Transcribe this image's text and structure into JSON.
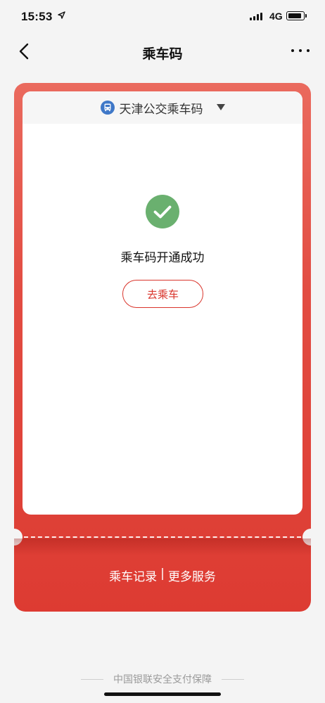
{
  "status_bar": {
    "time": "15:53",
    "network": "4G"
  },
  "nav": {
    "title": "乘车码",
    "back_icon": "chevron-left-icon",
    "more_icon": "ellipsis-icon"
  },
  "card": {
    "route_name": "天津公交乘车码",
    "route_icon": "bus-icon",
    "status_icon": "check-circle-icon",
    "status_text": "乘车码开通成功",
    "action_label": "去乘车",
    "footer_links": [
      {
        "label": "乘车记录"
      },
      {
        "label": "更多服务"
      }
    ],
    "footer_separator": "|"
  },
  "footer": {
    "guarantee": "中国银联安全支付保障"
  },
  "colors": {
    "accent": "#d9342b",
    "success": "#6ab06f",
    "route_icon": "#3f78c8"
  }
}
